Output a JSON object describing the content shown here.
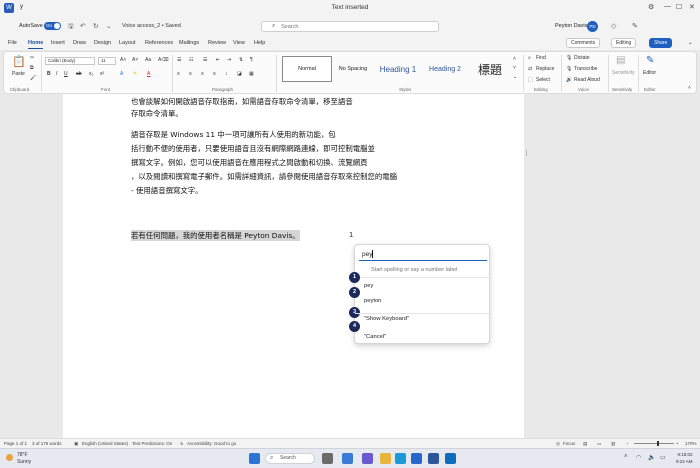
{
  "window": {
    "doc_short": "y",
    "title": "Text inserted",
    "controls": [
      "⚙",
      "—",
      "☐",
      "✕"
    ]
  },
  "titlebar": {
    "autosave_label": "AutoSave",
    "autosave_state": "On",
    "doc_name": "Voice access_2 • Saved",
    "search_placeholder": "Search",
    "user_name": "Peyton Davis",
    "user_initials": "PD"
  },
  "tabs": [
    "File",
    "Home",
    "Insert",
    "Draw",
    "Design",
    "Layout",
    "References",
    "Mailings",
    "Review",
    "View",
    "Help"
  ],
  "active_tab": "Home",
  "tab_buttons": {
    "comments": "Comments",
    "editing": "Editing",
    "share": "Share"
  },
  "ribbon": {
    "font_name": "Calibri (Body)",
    "font_size": "11",
    "paste_label": "Paste",
    "groups": {
      "clipboard": "Clipboard",
      "font": "Font",
      "paragraph": "Paragraph",
      "styles": "Styles",
      "editing": "Editing",
      "voice": "Voice",
      "sensitivity": "Sensitivity",
      "editor": "Editor"
    },
    "styles": {
      "normal": "Normal",
      "no_spacing": "No Spacing",
      "heading1": "Heading 1",
      "heading2": "Heading 2",
      "title": "標題"
    },
    "editing_items": [
      "Find",
      "Replace",
      "Select"
    ],
    "voice_items": [
      "Dictate",
      "Transcribe",
      "Read Aloud"
    ],
    "sensitivity_label": "Sensitivity",
    "editor_label": "Editor"
  },
  "document": {
    "para1_line1": "也會談解如何開啟語音存取指南，如需語音存取命令清單，移至語音",
    "para1_line2": "存取命令清單。",
    "para2_line1": "語音存取是 Windows 11 中一項可讓所有人使用的新功能，包",
    "para2_line2": "括行動不便的使用者，只要使用語音且沒有網際網路連線，即可控制電腦並",
    "para2_line3": "撰寫文字。例如，您可以使用語音在應用程式之間啟動和切換、流覽網頁",
    "para2_line4": "，以及閱讀和撰寫電子郵件。如需詳細資訊，請參閱使用語音存取來控制您的電腦",
    "para2_line5": "- 使用語音撰寫文字。",
    "para3_text": "若有任何問題，我的使用者名稱是 Peyton Davis。",
    "para3_marker": "1"
  },
  "voice_popup": {
    "input_value": "pey",
    "hint": "Start spelling or say a number label",
    "options": [
      {
        "num": "1",
        "label": ""
      },
      {
        "num": "2",
        "label": "pey"
      },
      {
        "num": "3",
        "label": "peyton"
      },
      {
        "num": "4",
        "label": "\"Show Keyboard\""
      },
      {
        "num": "",
        "label": "\"Cancel\""
      }
    ]
  },
  "statusbar": {
    "page": "Page 1 of 1",
    "words": "3 of 176 words",
    "language": "English (United States)",
    "predictions": "Text Predictions: On",
    "accessibility": "Accessibility: Good to go",
    "focus": "Focus",
    "zoom": "170%"
  },
  "taskbar": {
    "weather_temp": "78°F",
    "weather_desc": "Sunny",
    "search_label": "Search",
    "time": "9:15:02",
    "date": "9:22 AM"
  },
  "colors": {
    "accent": "#1f5fbf",
    "badge": "#1c2a5a",
    "highlight": "#d6d6d6"
  }
}
